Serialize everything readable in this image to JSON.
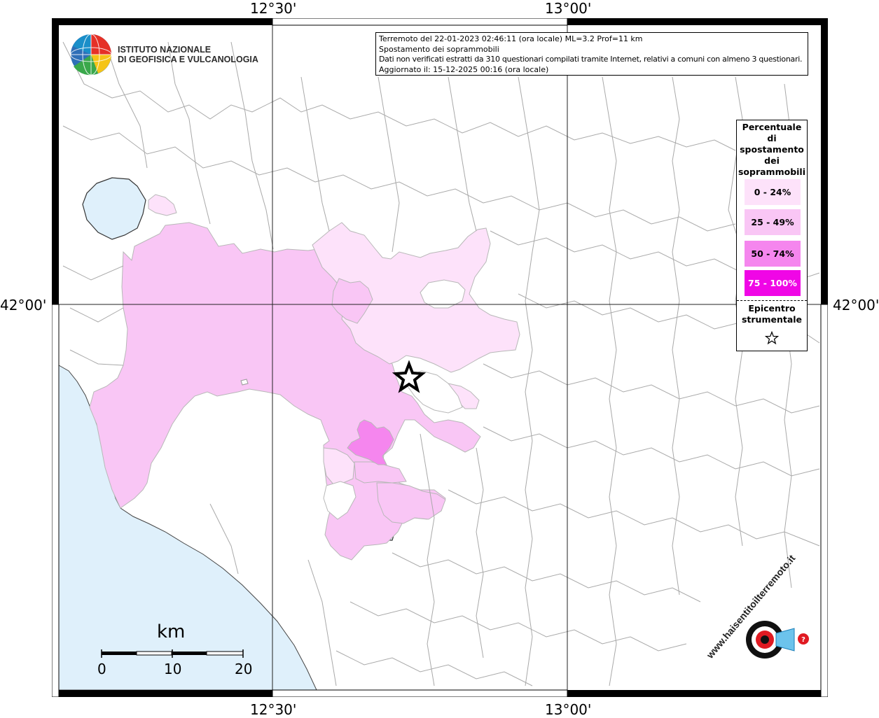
{
  "map": {
    "coord_labels": {
      "top_left_lon": "12°30'",
      "top_right_lon": "13°00'",
      "bottom_left_lon": "12°30'",
      "bottom_right_lon": "13°00'",
      "left_lat": "42°00'",
      "right_lat": "42°00'"
    },
    "colors": {
      "water": "#dff0fb",
      "class_0_24": "#fde2fa",
      "class_25_49": "#f9c6f5",
      "class_50_74": "#f586ee",
      "class_75_100": "#f006e6",
      "border": "#a8a8a8"
    }
  },
  "info": {
    "line1": "Terremoto del 22-01-2023 02:46:11 (ora locale) ML=3.2 Prof=11 km",
    "line2": "Spostamento dei soprammobili",
    "line3": "Dati non verificati estratti da 310 questionari compilati tramite Internet, relativi a comuni con almeno 3 questionari.",
    "line4": "Aggiornato il: 15-12-2025 00:16 (ora locale)"
  },
  "ingv_logo": {
    "line1": "ISTITUTO NAZIONALE",
    "line2": "DI GEOFISICA E VULCANOLOGIA"
  },
  "legend": {
    "title": [
      "Percentuale",
      "di",
      "spostamento",
      "dei",
      "soprammobili"
    ],
    "classes": [
      {
        "label": "0 - 24%",
        "color": "#fde2fa",
        "text_color": "#000000"
      },
      {
        "label": "25 - 49%",
        "color": "#f9c6f5",
        "text_color": "#000000"
      },
      {
        "label": "50 - 74%",
        "color": "#f586ee",
        "text_color": "#000000"
      },
      {
        "label": "75 - 100%",
        "color": "#f006e6",
        "text_color": "#ffffff"
      }
    ],
    "epicenter_title": [
      "Epicentro",
      "strumentale"
    ],
    "epicenter_icon": "star-icon"
  },
  "scale": {
    "unit": "km",
    "ticks": [
      "0",
      "10",
      "20"
    ]
  },
  "hsit_logo": {
    "text": "www.haisentitoilterremoto.it",
    "icon": "megaphone-icon"
  }
}
